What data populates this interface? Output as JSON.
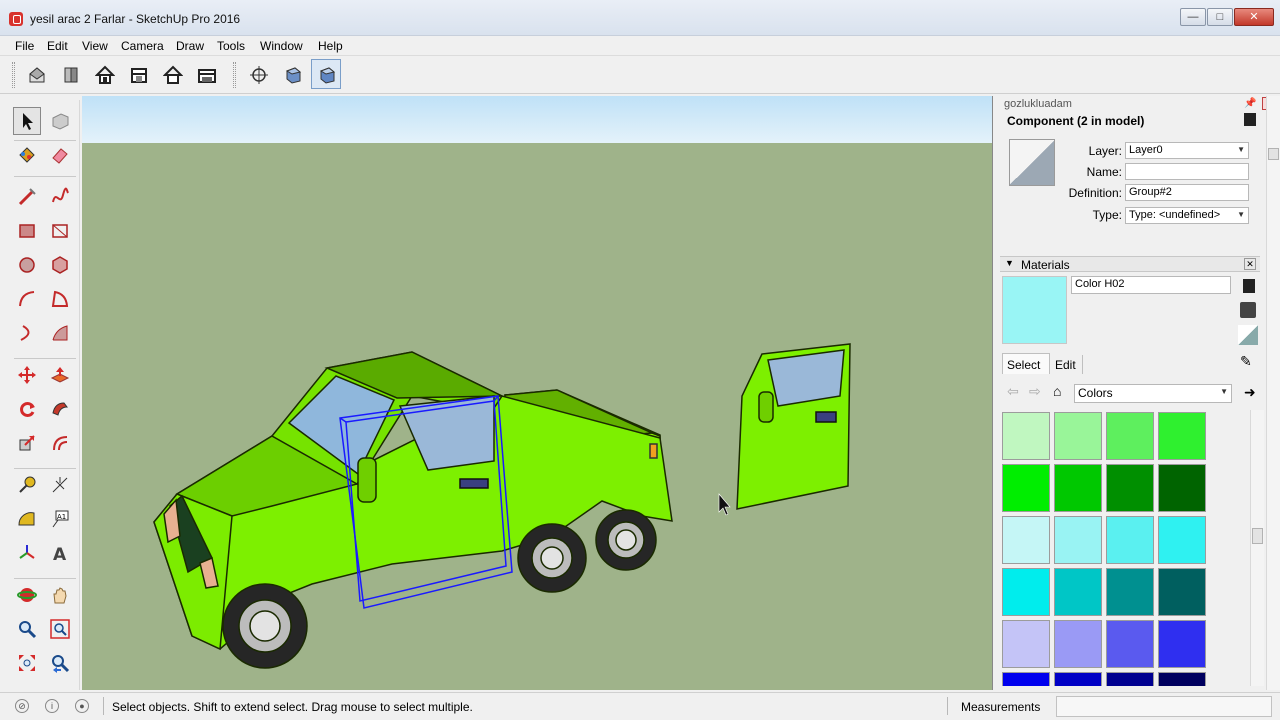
{
  "window": {
    "title": "yesil arac 2 Farlar - SketchUp Pro 2016",
    "minimize": "—",
    "maximize": "□",
    "close": "✕"
  },
  "menu": [
    "File",
    "Edit",
    "View",
    "Camera",
    "Draw",
    "Tools",
    "Window",
    "Help"
  ],
  "toolbar": {
    "buttons": [
      "iso-view",
      "front-view",
      "home",
      "right-view",
      "back-view",
      "top-view",
      "position-camera",
      "section-plane",
      "orbit"
    ],
    "active": "orbit"
  },
  "palette": {
    "tools": [
      "select",
      "component",
      "paint-bucket",
      "eraser",
      "line",
      "freehand",
      "rectangle",
      "rotated-rectangle",
      "circle",
      "polygon",
      "arc",
      "pie",
      "two-point-arc",
      "offset-arc",
      "move",
      "push-pull",
      "rotate",
      "follow-me",
      "scale",
      "offset",
      "tape-measure",
      "dimension",
      "protractor",
      "text",
      "axes",
      "3d-text",
      "orbit",
      "pan",
      "zoom",
      "zoom-window",
      "zoom-extents",
      "previous-view"
    ],
    "active": "select"
  },
  "entity_info": {
    "header": "gozlukluadam",
    "title": "Component (2 in model)",
    "layer_label": "Layer:",
    "layer_value": "Layer0",
    "name_label": "Name:",
    "name_value": "",
    "definition_label": "Definition:",
    "definition_value": "Group#2",
    "type_label": "Type:",
    "type_value": "Type: <undefined>"
  },
  "materials": {
    "title": "Materials",
    "current_name": "Color H02",
    "current_color": "#99f5f5",
    "tab_select": "Select",
    "tab_edit": "Edit",
    "collection": "Colors",
    "swatches": [
      "#c0f7c0",
      "#99f599",
      "#5eef5e",
      "#2ff02f",
      "#00ee00",
      "#00c800",
      "#008f00",
      "#006400",
      "#c5f6f6",
      "#99f3f3",
      "#5af0f0",
      "#2ff1f1",
      "#00eded",
      "#00c6c6",
      "#009090",
      "#005f5f",
      "#c4c4f7",
      "#9a9af5",
      "#5a5aef",
      "#2f2ff0",
      "#0000ee",
      "#0000c6",
      "#000090",
      "#00005f"
    ]
  },
  "status": {
    "text": "Select objects. Shift to extend select. Drag mouse to select multiple.",
    "measurements_label": "Measurements",
    "measurements_value": ""
  },
  "colors": {
    "viewport_ground": "#9fb38a",
    "car_body": "#7df000",
    "selection": "#1a1aff"
  }
}
